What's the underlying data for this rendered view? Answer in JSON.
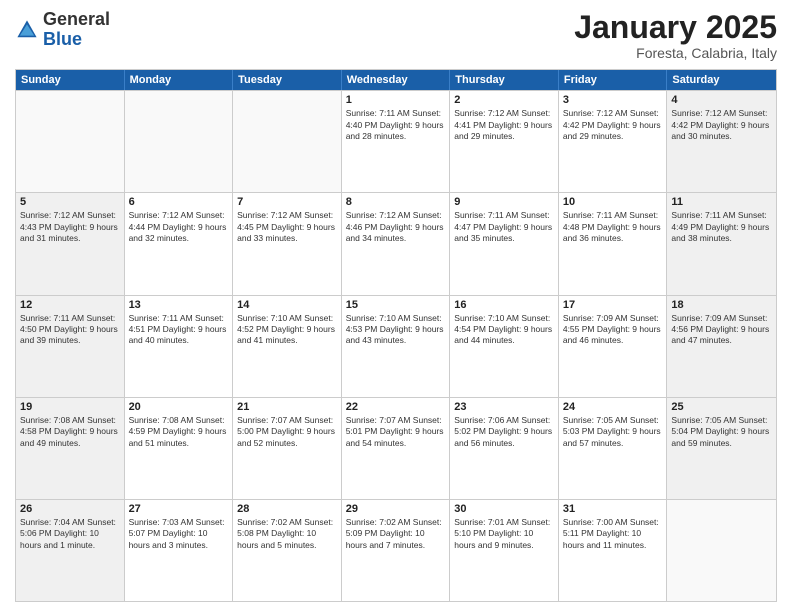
{
  "logo": {
    "general": "General",
    "blue": "Blue"
  },
  "header": {
    "title": "January 2025",
    "subtitle": "Foresta, Calabria, Italy"
  },
  "weekdays": [
    "Sunday",
    "Monday",
    "Tuesday",
    "Wednesday",
    "Thursday",
    "Friday",
    "Saturday"
  ],
  "weeks": [
    [
      {
        "day": "",
        "text": "",
        "shaded": false,
        "empty": true
      },
      {
        "day": "",
        "text": "",
        "shaded": false,
        "empty": true
      },
      {
        "day": "",
        "text": "",
        "shaded": false,
        "empty": true
      },
      {
        "day": "1",
        "text": "Sunrise: 7:11 AM\nSunset: 4:40 PM\nDaylight: 9 hours and 28 minutes.",
        "shaded": false,
        "empty": false
      },
      {
        "day": "2",
        "text": "Sunrise: 7:12 AM\nSunset: 4:41 PM\nDaylight: 9 hours and 29 minutes.",
        "shaded": false,
        "empty": false
      },
      {
        "day": "3",
        "text": "Sunrise: 7:12 AM\nSunset: 4:42 PM\nDaylight: 9 hours and 29 minutes.",
        "shaded": false,
        "empty": false
      },
      {
        "day": "4",
        "text": "Sunrise: 7:12 AM\nSunset: 4:42 PM\nDaylight: 9 hours and 30 minutes.",
        "shaded": true,
        "empty": false
      }
    ],
    [
      {
        "day": "5",
        "text": "Sunrise: 7:12 AM\nSunset: 4:43 PM\nDaylight: 9 hours and 31 minutes.",
        "shaded": true,
        "empty": false
      },
      {
        "day": "6",
        "text": "Sunrise: 7:12 AM\nSunset: 4:44 PM\nDaylight: 9 hours and 32 minutes.",
        "shaded": false,
        "empty": false
      },
      {
        "day": "7",
        "text": "Sunrise: 7:12 AM\nSunset: 4:45 PM\nDaylight: 9 hours and 33 minutes.",
        "shaded": false,
        "empty": false
      },
      {
        "day": "8",
        "text": "Sunrise: 7:12 AM\nSunset: 4:46 PM\nDaylight: 9 hours and 34 minutes.",
        "shaded": false,
        "empty": false
      },
      {
        "day": "9",
        "text": "Sunrise: 7:11 AM\nSunset: 4:47 PM\nDaylight: 9 hours and 35 minutes.",
        "shaded": false,
        "empty": false
      },
      {
        "day": "10",
        "text": "Sunrise: 7:11 AM\nSunset: 4:48 PM\nDaylight: 9 hours and 36 minutes.",
        "shaded": false,
        "empty": false
      },
      {
        "day": "11",
        "text": "Sunrise: 7:11 AM\nSunset: 4:49 PM\nDaylight: 9 hours and 38 minutes.",
        "shaded": true,
        "empty": false
      }
    ],
    [
      {
        "day": "12",
        "text": "Sunrise: 7:11 AM\nSunset: 4:50 PM\nDaylight: 9 hours and 39 minutes.",
        "shaded": true,
        "empty": false
      },
      {
        "day": "13",
        "text": "Sunrise: 7:11 AM\nSunset: 4:51 PM\nDaylight: 9 hours and 40 minutes.",
        "shaded": false,
        "empty": false
      },
      {
        "day": "14",
        "text": "Sunrise: 7:10 AM\nSunset: 4:52 PM\nDaylight: 9 hours and 41 minutes.",
        "shaded": false,
        "empty": false
      },
      {
        "day": "15",
        "text": "Sunrise: 7:10 AM\nSunset: 4:53 PM\nDaylight: 9 hours and 43 minutes.",
        "shaded": false,
        "empty": false
      },
      {
        "day": "16",
        "text": "Sunrise: 7:10 AM\nSunset: 4:54 PM\nDaylight: 9 hours and 44 minutes.",
        "shaded": false,
        "empty": false
      },
      {
        "day": "17",
        "text": "Sunrise: 7:09 AM\nSunset: 4:55 PM\nDaylight: 9 hours and 46 minutes.",
        "shaded": false,
        "empty": false
      },
      {
        "day": "18",
        "text": "Sunrise: 7:09 AM\nSunset: 4:56 PM\nDaylight: 9 hours and 47 minutes.",
        "shaded": true,
        "empty": false
      }
    ],
    [
      {
        "day": "19",
        "text": "Sunrise: 7:08 AM\nSunset: 4:58 PM\nDaylight: 9 hours and 49 minutes.",
        "shaded": true,
        "empty": false
      },
      {
        "day": "20",
        "text": "Sunrise: 7:08 AM\nSunset: 4:59 PM\nDaylight: 9 hours and 51 minutes.",
        "shaded": false,
        "empty": false
      },
      {
        "day": "21",
        "text": "Sunrise: 7:07 AM\nSunset: 5:00 PM\nDaylight: 9 hours and 52 minutes.",
        "shaded": false,
        "empty": false
      },
      {
        "day": "22",
        "text": "Sunrise: 7:07 AM\nSunset: 5:01 PM\nDaylight: 9 hours and 54 minutes.",
        "shaded": false,
        "empty": false
      },
      {
        "day": "23",
        "text": "Sunrise: 7:06 AM\nSunset: 5:02 PM\nDaylight: 9 hours and 56 minutes.",
        "shaded": false,
        "empty": false
      },
      {
        "day": "24",
        "text": "Sunrise: 7:05 AM\nSunset: 5:03 PM\nDaylight: 9 hours and 57 minutes.",
        "shaded": false,
        "empty": false
      },
      {
        "day": "25",
        "text": "Sunrise: 7:05 AM\nSunset: 5:04 PM\nDaylight: 9 hours and 59 minutes.",
        "shaded": true,
        "empty": false
      }
    ],
    [
      {
        "day": "26",
        "text": "Sunrise: 7:04 AM\nSunset: 5:06 PM\nDaylight: 10 hours and 1 minute.",
        "shaded": true,
        "empty": false
      },
      {
        "day": "27",
        "text": "Sunrise: 7:03 AM\nSunset: 5:07 PM\nDaylight: 10 hours and 3 minutes.",
        "shaded": false,
        "empty": false
      },
      {
        "day": "28",
        "text": "Sunrise: 7:02 AM\nSunset: 5:08 PM\nDaylight: 10 hours and 5 minutes.",
        "shaded": false,
        "empty": false
      },
      {
        "day": "29",
        "text": "Sunrise: 7:02 AM\nSunset: 5:09 PM\nDaylight: 10 hours and 7 minutes.",
        "shaded": false,
        "empty": false
      },
      {
        "day": "30",
        "text": "Sunrise: 7:01 AM\nSunset: 5:10 PM\nDaylight: 10 hours and 9 minutes.",
        "shaded": false,
        "empty": false
      },
      {
        "day": "31",
        "text": "Sunrise: 7:00 AM\nSunset: 5:11 PM\nDaylight: 10 hours and 11 minutes.",
        "shaded": false,
        "empty": false
      },
      {
        "day": "",
        "text": "",
        "shaded": true,
        "empty": true
      }
    ]
  ]
}
